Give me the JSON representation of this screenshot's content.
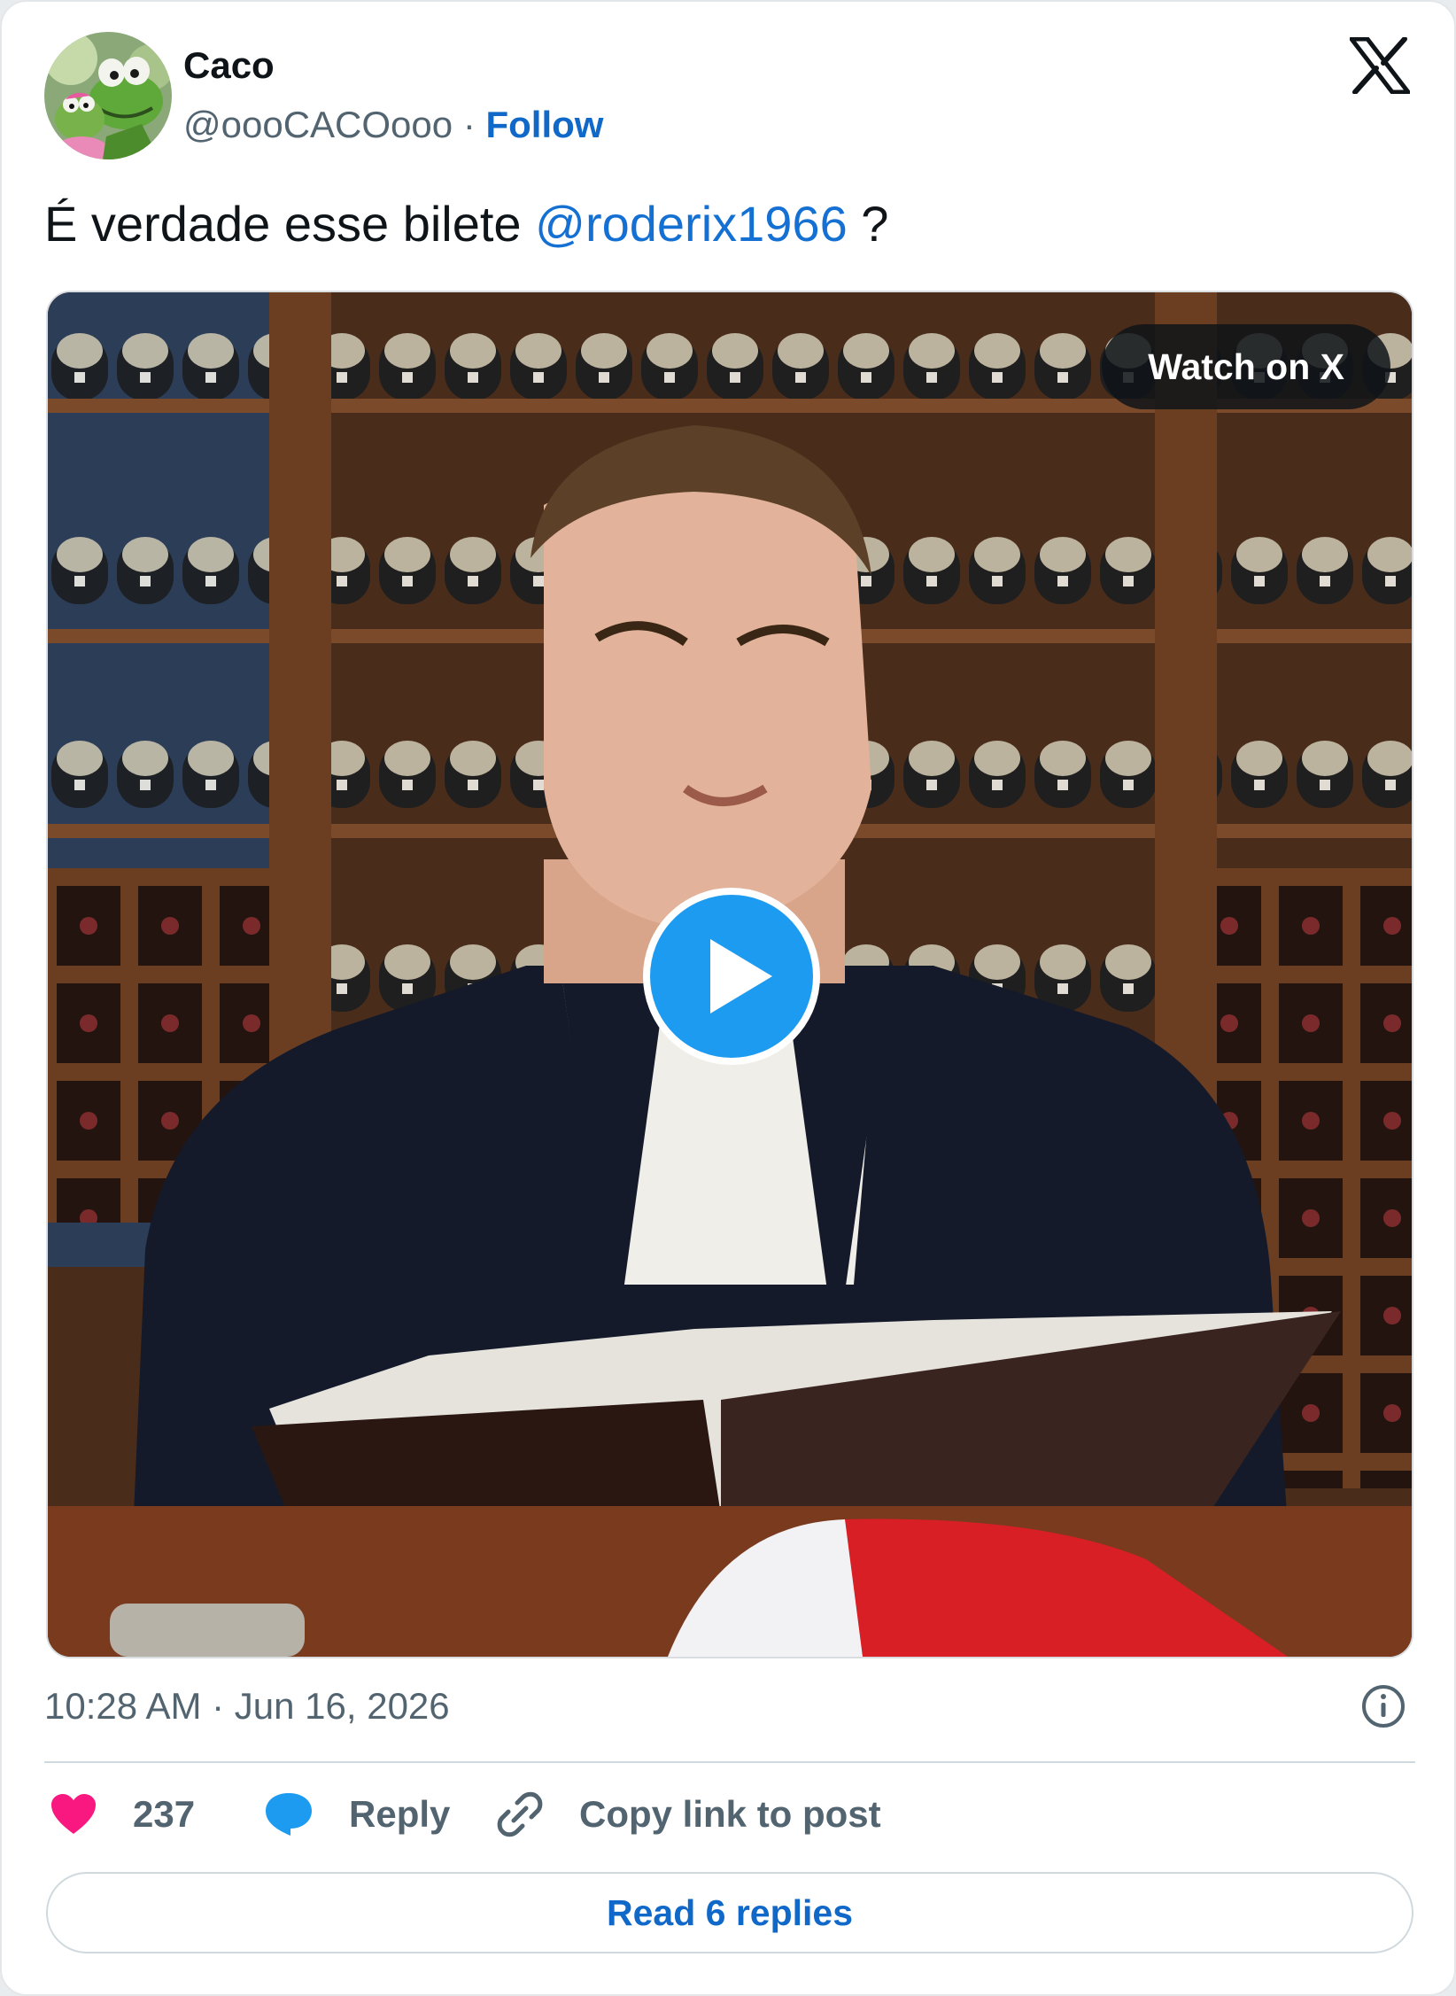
{
  "author": {
    "name": "Caco",
    "handle": "@oooCACOooo",
    "separator": "·",
    "follow_label": "Follow",
    "avatar_icon": "frog-avatar"
  },
  "tweet": {
    "text_before": "É verdade esse bilete ",
    "mention": "@roderix1966",
    "text_after": " ?"
  },
  "media": {
    "watch_label": "Watch on X",
    "play_icon": "play-icon"
  },
  "meta": {
    "timestamp": "10:28 AM · Jun 16, 2026"
  },
  "actions": {
    "like_count": "237",
    "reply_label": "Reply",
    "copy_label": "Copy link to post",
    "read_replies_label": "Read 6 replies"
  },
  "colors": {
    "link": "#1570d3",
    "like": "#f91880",
    "reply": "#1d9bf0",
    "muted": "#536471",
    "play": "#1d9bf0"
  }
}
